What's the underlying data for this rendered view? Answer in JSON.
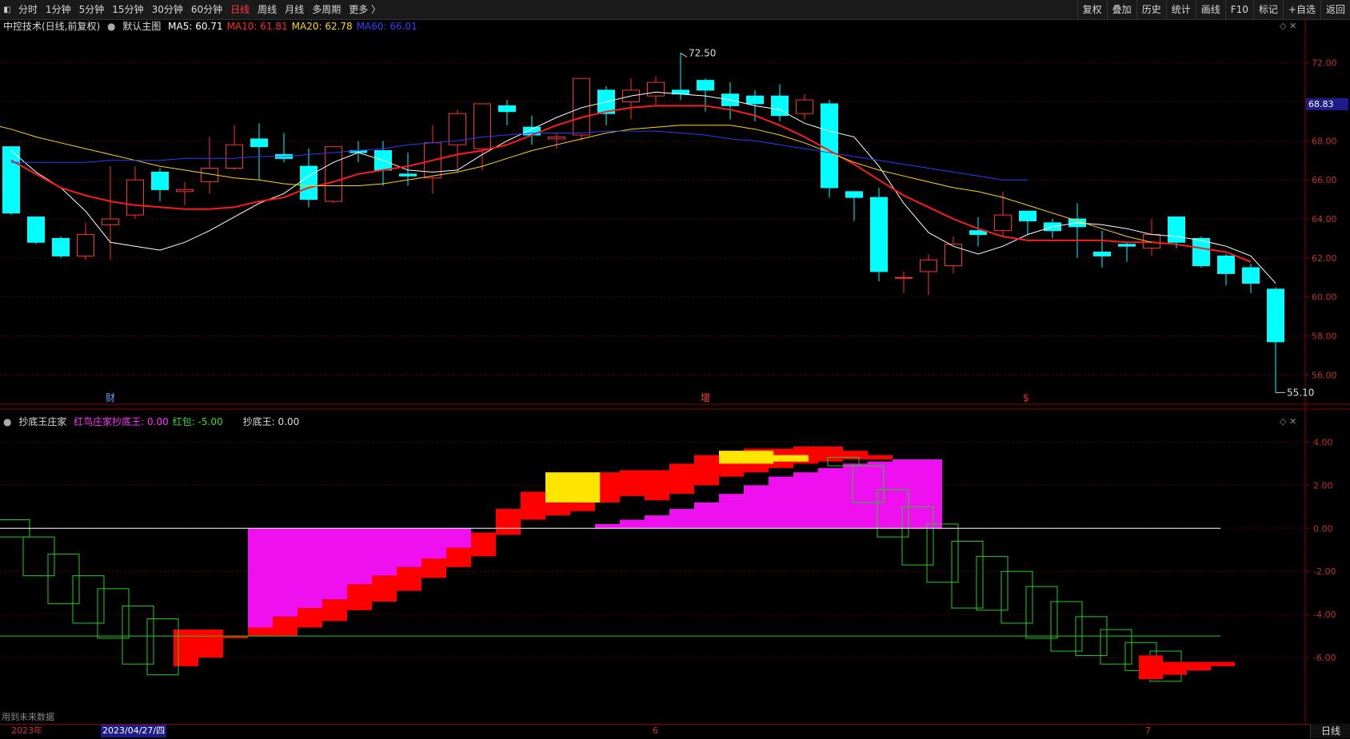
{
  "toolbar": {
    "periods": [
      "分时",
      "1分钟",
      "5分钟",
      "15分钟",
      "30分钟",
      "60分钟",
      "日线",
      "周线",
      "月线",
      "多周期",
      "更多 〉"
    ],
    "active": "日线",
    "right": [
      "复权",
      "叠加",
      "历史",
      "统计",
      "画线",
      "F10",
      "标记",
      "+自选",
      "返回"
    ]
  },
  "main": {
    "title": "中控技术(日线,前复权)",
    "template_label": "默认主图",
    "ma": [
      {
        "label": "MA5: 60.71",
        "color": "#ffffff"
      },
      {
        "label": "MA10: 61.81",
        "color": "#ff2a2a"
      },
      {
        "label": "MA20: 62.78",
        "color": "#ffd700"
      },
      {
        "label": "MA60: 66.01",
        "color": "#3340ff"
      }
    ],
    "high_label": "72.50",
    "low_label": "55.10",
    "current_price": "68.83",
    "price_ticks": [
      "72.00",
      "70.00",
      "68.00",
      "66.00",
      "64.00",
      "62.00",
      "60.00",
      "58.00",
      "56.00"
    ],
    "markers": [
      {
        "text": "财",
        "color": "#5aa0ff"
      },
      {
        "text": "增",
        "color": "#ff4040"
      },
      {
        "text": "$",
        "color": "#ff2020"
      }
    ]
  },
  "sub": {
    "title": "抄底王庄家",
    "series_labels": [
      {
        "label": "红鸟庄家抄底王: 0.00",
        "color": "#ff33ff"
      },
      {
        "label": "红包: -5.00",
        "color": "#33dd33"
      },
      {
        "label": "抄底王: 0.00",
        "color": "#dddddd"
      }
    ],
    "ticks": [
      "4.00",
      "2.00",
      "0.00",
      "-2.00",
      "-4.00",
      "-6.00"
    ]
  },
  "footer": {
    "note": "用到未来数据",
    "year_label": "2023年",
    "cursor_date": "2023/04/27/四",
    "month_labels": [
      "6",
      "7"
    ],
    "period_button": "日线"
  },
  "colors": {
    "up": "#ff3030",
    "down": "#00ffff",
    "grid": "#5a0000",
    "bg": "#000000"
  },
  "chart_data": [
    {
      "type": "candlestick",
      "title": "中控技术(日线,前复权)",
      "ylim": [
        54.5,
        73.5
      ],
      "candles": [
        [
          67.7,
          64.3,
          67.7,
          64.2
        ],
        [
          64.1,
          62.8,
          64.1,
          62.7
        ],
        [
          63.0,
          62.1,
          63.1,
          62.0
        ],
        [
          62.1,
          63.2,
          63.8,
          61.9
        ],
        [
          63.7,
          64.0,
          66.7,
          61.9
        ],
        [
          64.2,
          66.0,
          66.7,
          64.0
        ],
        [
          66.4,
          65.5,
          66.6,
          64.9
        ],
        [
          65.4,
          65.5,
          65.9,
          64.7
        ],
        [
          65.9,
          66.6,
          68.2,
          65.3
        ],
        [
          66.6,
          67.8,
          68.8,
          66.5
        ],
        [
          68.1,
          67.7,
          68.9,
          66.0
        ],
        [
          67.3,
          67.1,
          68.4,
          66.9
        ],
        [
          66.7,
          65.0,
          67.6,
          64.6
        ],
        [
          64.9,
          67.7,
          67.7,
          64.8
        ],
        [
          67.5,
          67.4,
          68.0,
          66.9
        ],
        [
          67.5,
          66.5,
          68.0,
          65.7
        ],
        [
          66.3,
          66.2,
          67.4,
          65.7
        ],
        [
          66.1,
          67.9,
          68.8,
          65.3
        ],
        [
          67.8,
          69.4,
          69.6,
          66.4
        ],
        [
          67.6,
          69.9,
          69.9,
          66.5
        ],
        [
          69.8,
          69.5,
          70.1,
          68.8
        ],
        [
          68.7,
          68.3,
          69.3,
          67.8
        ],
        [
          68.1,
          68.2,
          68.4,
          67.6
        ],
        [
          68.3,
          71.2,
          71.2,
          68.0
        ],
        [
          70.6,
          69.4,
          70.8,
          68.8
        ],
        [
          70.0,
          70.6,
          71.2,
          69.1
        ],
        [
          70.3,
          71.0,
          71.3,
          69.8
        ],
        [
          70.6,
          70.4,
          72.5,
          70.1
        ],
        [
          71.1,
          70.6,
          71.2,
          69.5
        ],
        [
          70.4,
          69.8,
          71.0,
          69.1
        ],
        [
          70.3,
          69.9,
          70.6,
          69.0
        ],
        [
          70.3,
          69.3,
          70.9,
          69.0
        ],
        [
          69.4,
          70.1,
          70.4,
          69.1
        ],
        [
          69.9,
          65.6,
          70.1,
          65.1
        ],
        [
          65.4,
          65.1,
          65.4,
          63.9
        ],
        [
          65.1,
          61.3,
          65.6,
          60.8
        ],
        [
          61.0,
          61.0,
          61.3,
          60.2
        ],
        [
          61.3,
          61.9,
          62.2,
          60.1
        ],
        [
          61.6,
          62.7,
          63.1,
          61.2
        ],
        [
          63.4,
          63.2,
          64.1,
          62.6
        ],
        [
          63.4,
          64.2,
          65.4,
          63.1
        ],
        [
          64.4,
          63.9,
          64.4,
          63.2
        ],
        [
          63.8,
          63.4,
          64.0,
          63.0
        ],
        [
          64.0,
          63.6,
          64.8,
          62.0
        ],
        [
          62.3,
          62.1,
          63.4,
          61.5
        ],
        [
          62.7,
          62.6,
          62.8,
          61.8
        ],
        [
          62.5,
          63.2,
          64.0,
          62.1
        ],
        [
          64.1,
          62.8,
          64.1,
          62.5
        ],
        [
          63.0,
          61.6,
          63.1,
          61.5
        ],
        [
          62.1,
          61.2,
          62.2,
          60.6
        ],
        [
          61.5,
          60.7,
          61.7,
          60.2
        ],
        [
          60.4,
          57.7,
          60.5,
          55.1
        ]
      ],
      "ma5": [
        67.5,
        66.4,
        65.6,
        64.4,
        62.8,
        62.6,
        62.4,
        62.8,
        63.4,
        64.1,
        64.8,
        65.3,
        66.2,
        66.9,
        67.4,
        67.0,
        66.5,
        66.4,
        66.5,
        67.3,
        68.0,
        68.6,
        69.2,
        69.7,
        70.0,
        70.3,
        70.5,
        70.4,
        70.3,
        70.1,
        69.8,
        69.6,
        68.9,
        68.5,
        68.2,
        66.7,
        64.8,
        63.3,
        62.6,
        62.2,
        62.6,
        63.2,
        63.6,
        63.8,
        63.7,
        63.5,
        63.2,
        63.1,
        62.9,
        62.6,
        62.1,
        60.7
      ],
      "ma10": [
        67.0,
        66.3,
        65.6,
        65.2,
        64.9,
        64.7,
        64.6,
        64.5,
        64.5,
        64.6,
        64.9,
        65.1,
        65.6,
        65.9,
        66.3,
        66.5,
        66.7,
        67.0,
        67.3,
        67.5,
        67.8,
        68.3,
        68.8,
        69.2,
        69.5,
        69.7,
        69.8,
        69.8,
        69.8,
        69.6,
        69.3,
        68.8,
        68.2,
        67.5,
        66.8,
        66.0,
        65.2,
        64.6,
        64.0,
        63.5,
        63.1,
        62.9,
        62.9,
        62.9,
        62.9,
        62.8,
        62.8,
        62.7,
        62.5,
        62.3,
        61.8
      ],
      "ma20": [
        69.2,
        68.9,
        68.6,
        68.2,
        67.9,
        67.6,
        67.3,
        67.0,
        66.7,
        66.5,
        66.3,
        66.1,
        66.0,
        65.8,
        65.7,
        65.7,
        65.7,
        65.8,
        66.0,
        66.2,
        66.4,
        66.7,
        67.1,
        67.5,
        67.8,
        68.1,
        68.4,
        68.6,
        68.7,
        68.8,
        68.8,
        68.8,
        68.6,
        68.3,
        67.9,
        67.4,
        66.9,
        66.5,
        66.2,
        65.9,
        65.6,
        65.4,
        65.1,
        64.7,
        64.3,
        63.9,
        63.5,
        63.1,
        62.8
      ],
      "ma60": [
        66.9,
        66.9,
        66.9,
        66.9,
        67.0,
        67.0,
        67.0,
        67.1,
        67.1,
        67.1,
        67.2,
        67.2,
        67.3,
        67.4,
        67.5,
        67.6,
        67.8,
        67.9,
        68.0,
        68.2,
        68.3,
        68.4,
        68.4,
        68.4,
        68.5,
        68.5,
        68.5,
        68.4,
        68.3,
        68.1,
        68.0,
        67.8,
        67.6,
        67.4,
        67.2,
        67.0,
        66.8,
        66.6,
        66.4,
        66.2,
        66.0,
        66.0
      ]
    },
    {
      "type": "bar",
      "title": "抄底王庄家",
      "ylim": [
        -9,
        5.5
      ],
      "green_steps": [
        [
          0.4,
          -0.4
        ],
        [
          -0.4,
          -2.2
        ],
        [
          -1.2,
          -3.5
        ],
        [
          -2.2,
          -4.4
        ],
        [
          -2.8,
          -5.1
        ],
        [
          -3.6,
          -6.3
        ],
        [
          -4.2,
          -6.8
        ]
      ],
      "red_steps": [
        [
          -4.7,
          -6.4
        ],
        [
          -4.7,
          -6.0
        ],
        [
          -5.0,
          -5.1
        ],
        [
          -4.6,
          -5.0
        ],
        [
          -4.1,
          -5.0
        ],
        [
          -3.7,
          -4.6
        ],
        [
          -3.3,
          -4.3
        ],
        [
          -2.6,
          -3.8
        ],
        [
          -2.2,
          -3.4
        ],
        [
          -1.8,
          -2.9
        ],
        [
          -1.4,
          -2.3
        ],
        [
          -0.9,
          -1.8
        ],
        [
          -0.2,
          -1.3
        ],
        [
          0.9,
          -0.3
        ],
        [
          1.7,
          0.4
        ],
        [
          2.0,
          0.6
        ],
        [
          2.3,
          0.8
        ],
        [
          2.6,
          1.2
        ],
        [
          2.7,
          1.5
        ],
        [
          2.7,
          1.3
        ],
        [
          3.0,
          1.6
        ],
        [
          3.4,
          2.0
        ],
        [
          3.6,
          2.4
        ],
        [
          3.7,
          2.6
        ],
        [
          3.7,
          2.8
        ],
        [
          3.8,
          3.0
        ],
        [
          3.8,
          3.1
        ],
        [
          3.6,
          3.2
        ],
        [
          3.4,
          3.2
        ]
      ],
      "magenta": [
        -4.7,
        -4.1,
        -3.7,
        -3.3,
        -2.6,
        -2.2,
        -1.8,
        -1.4,
        -0.9,
        0,
        0,
        0,
        0,
        0,
        0.2,
        0.4,
        0.6,
        0.9,
        1.2,
        1.6,
        2.0,
        2.4,
        2.6,
        2.8,
        3.0,
        3.1,
        3.2,
        3.2
      ],
      "yellow": [
        [
          2.6,
          1.2
        ],
        [
          3.6,
          3.0
        ],
        [
          3.4,
          3.1
        ]
      ],
      "green_steps2": [
        [
          3.3,
          2.9
        ],
        [
          2.9,
          1.2
        ],
        [
          1.8,
          -0.4
        ],
        [
          1.0,
          -1.7
        ],
        [
          0.2,
          -2.5
        ],
        [
          -0.6,
          -3.7
        ],
        [
          -1.3,
          -3.8
        ],
        [
          -2.0,
          -4.4
        ],
        [
          -2.7,
          -5.1
        ],
        [
          -3.4,
          -5.7
        ],
        [
          -4.1,
          -5.9
        ],
        [
          -4.7,
          -6.3
        ],
        [
          -5.3,
          -6.6
        ],
        [
          -5.7,
          -7.1
        ]
      ],
      "red_tail": [
        [
          -5.9,
          -7.0
        ],
        [
          -6.2,
          -6.8
        ],
        [
          -6.2,
          -6.6
        ],
        [
          -6.2,
          -6.4
        ]
      ],
      "zero_line": 0,
      "red_line": -5.0
    }
  ]
}
